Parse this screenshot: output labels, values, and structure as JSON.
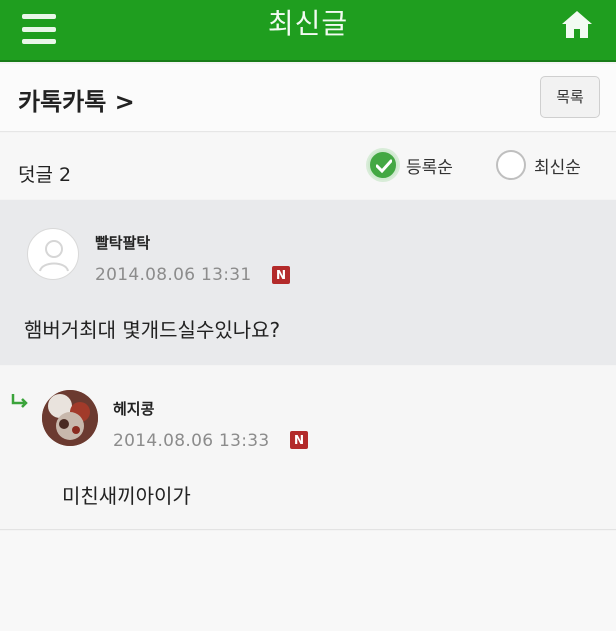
{
  "topbar": {
    "title": "최신글",
    "menu_icon": "hamburger-menu-icon",
    "home_icon": "home-icon",
    "color": "#1f9e1f"
  },
  "board": {
    "name": "카톡카톡 >",
    "list_button": "목록"
  },
  "comments_header": {
    "count_label": "덧글 2",
    "sort_options": [
      {
        "label": "등록순",
        "selected": true
      },
      {
        "label": "최신순",
        "selected": false
      }
    ]
  },
  "comments": [
    {
      "nickname": "빨탁팔탁",
      "date": "2014.08.06 13:31",
      "badge": "N",
      "text": "햄버거최대 몇개드실수있나요?",
      "is_reply": false
    },
    {
      "nickname": "헤지콩",
      "date": "2014.08.06 13:33",
      "badge": "N",
      "text": "미친새끼아이가",
      "is_reply": true
    }
  ]
}
